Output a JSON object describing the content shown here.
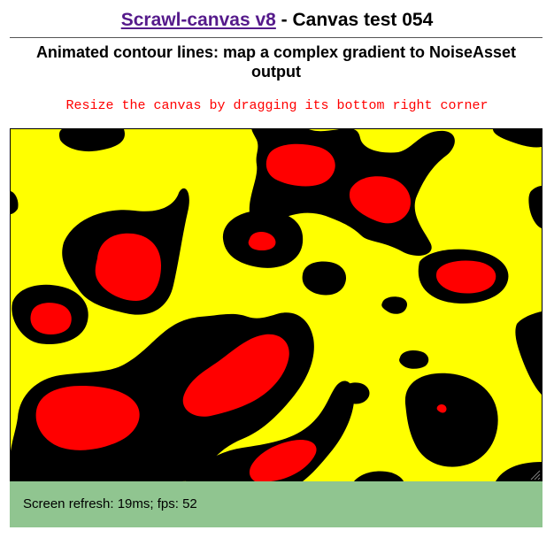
{
  "header": {
    "link_text": "Scrawl-canvas v8",
    "title_rest": " - Canvas test 054"
  },
  "subtitle": "Animated contour lines: map a complex gradient to NoiseAsset output",
  "instruction": "Resize the canvas by dragging its bottom right corner",
  "status": {
    "text": "Screen refresh: 19ms; fps: 52"
  },
  "colors": {
    "link": "#551a8b",
    "instruction": "#ff0000",
    "canvas_low": "#ffff00",
    "canvas_mid": "#000000",
    "canvas_high": "#ff0000",
    "status_background": "#90c590"
  },
  "icons": {
    "resize_handle": "resize-grip-icon"
  }
}
